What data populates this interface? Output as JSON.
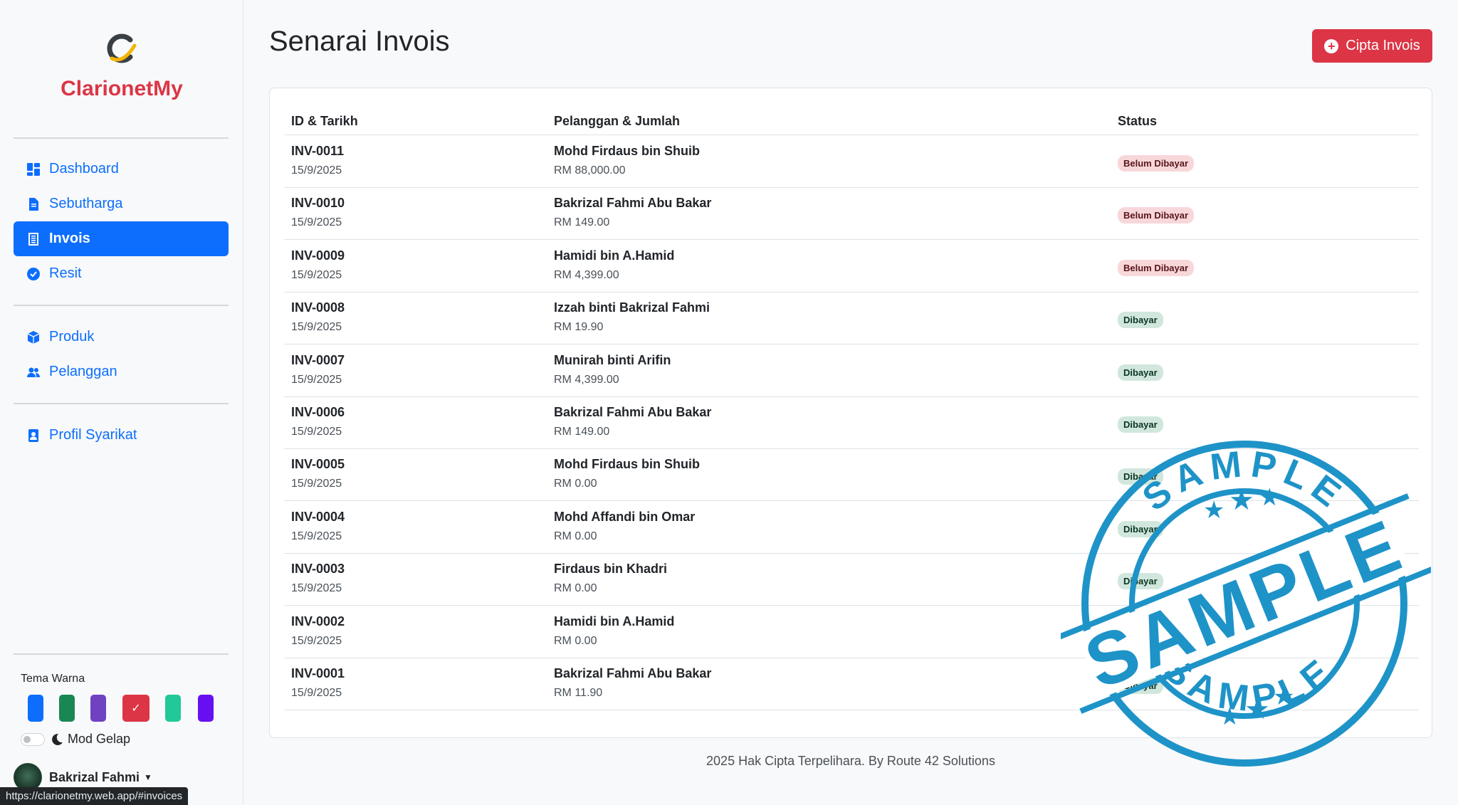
{
  "sidebar": {
    "brand": "ClarionetMy",
    "nav": [
      {
        "label": "Dashboard",
        "icon": "dashboard-icon",
        "active": false
      },
      {
        "label": "Sebutharga",
        "icon": "document-icon",
        "active": false
      },
      {
        "label": "Invois",
        "icon": "invoice-icon",
        "active": true
      },
      {
        "label": "Resit",
        "icon": "verified-badge-icon",
        "active": false
      },
      {
        "label": "Produk",
        "icon": "box-icon",
        "active": false
      },
      {
        "label": "Pelanggan",
        "icon": "people-icon",
        "active": false
      },
      {
        "label": "Profil Syarikat",
        "icon": "person-badge-icon",
        "active": false
      }
    ],
    "theme_label": "Tema Warna",
    "theme_colors": [
      "#0d6efd",
      "#198754",
      "#6f42c1",
      "#dc3545",
      "#20c997",
      "#6610f2"
    ],
    "selected_theme": "#dc3545",
    "dark_mode_label": "Mod Gelap",
    "dark_mode": false,
    "user_name": "Bakrizal Fahmi"
  },
  "statusbar_url": "https://clarionetmy.web.app/#invoices",
  "main": {
    "title": "Senarai Invois",
    "create_button": "Cipta Invois"
  },
  "table": {
    "headers": [
      "ID & Tarikh",
      "Pelanggan & Jumlah",
      "Status"
    ],
    "rows": [
      {
        "id": "INV-0011",
        "date": "15/9/2025",
        "customer": "Mohd Firdaus bin Shuib",
        "amount": "RM 88,000.00",
        "status": "Belum Dibayar",
        "paid": false
      },
      {
        "id": "INV-0010",
        "date": "15/9/2025",
        "customer": "Bakrizal Fahmi Abu Bakar",
        "amount": "RM 149.00",
        "status": "Belum Dibayar",
        "paid": false
      },
      {
        "id": "INV-0009",
        "date": "15/9/2025",
        "customer": "Hamidi bin A.Hamid",
        "amount": "RM 4,399.00",
        "status": "Belum Dibayar",
        "paid": false
      },
      {
        "id": "INV-0008",
        "date": "15/9/2025",
        "customer": "Izzah binti Bakrizal Fahmi",
        "amount": "RM 19.90",
        "status": "Dibayar",
        "paid": true
      },
      {
        "id": "INV-0007",
        "date": "15/9/2025",
        "customer": "Munirah binti Arifin",
        "amount": "RM 4,399.00",
        "status": "Dibayar",
        "paid": true
      },
      {
        "id": "INV-0006",
        "date": "15/9/2025",
        "customer": "Bakrizal Fahmi Abu Bakar",
        "amount": "RM 149.00",
        "status": "Dibayar",
        "paid": true
      },
      {
        "id": "INV-0005",
        "date": "15/9/2025",
        "customer": "Mohd Firdaus bin Shuib",
        "amount": "RM 0.00",
        "status": "Dibayar",
        "paid": true
      },
      {
        "id": "INV-0004",
        "date": "15/9/2025",
        "customer": "Mohd Affandi bin Omar",
        "amount": "RM 0.00",
        "status": "Dibayar",
        "paid": true
      },
      {
        "id": "INV-0003",
        "date": "15/9/2025",
        "customer": "Firdaus bin Khadri",
        "amount": "RM 0.00",
        "status": "Dibayar",
        "paid": true
      },
      {
        "id": "INV-0002",
        "date": "15/9/2025",
        "customer": "Hamidi bin A.Hamid",
        "amount": "RM 0.00",
        "status": "Dibayar",
        "paid": true
      },
      {
        "id": "INV-0001",
        "date": "15/9/2025",
        "customer": "Bakrizal Fahmi Abu Bakar",
        "amount": "RM 11.90",
        "status": "Dibayar",
        "paid": true
      }
    ]
  },
  "footer": "2025 Hak Cipta Terpelihara. By Route 42 Solutions",
  "stamp_text": "SAMPLE"
}
